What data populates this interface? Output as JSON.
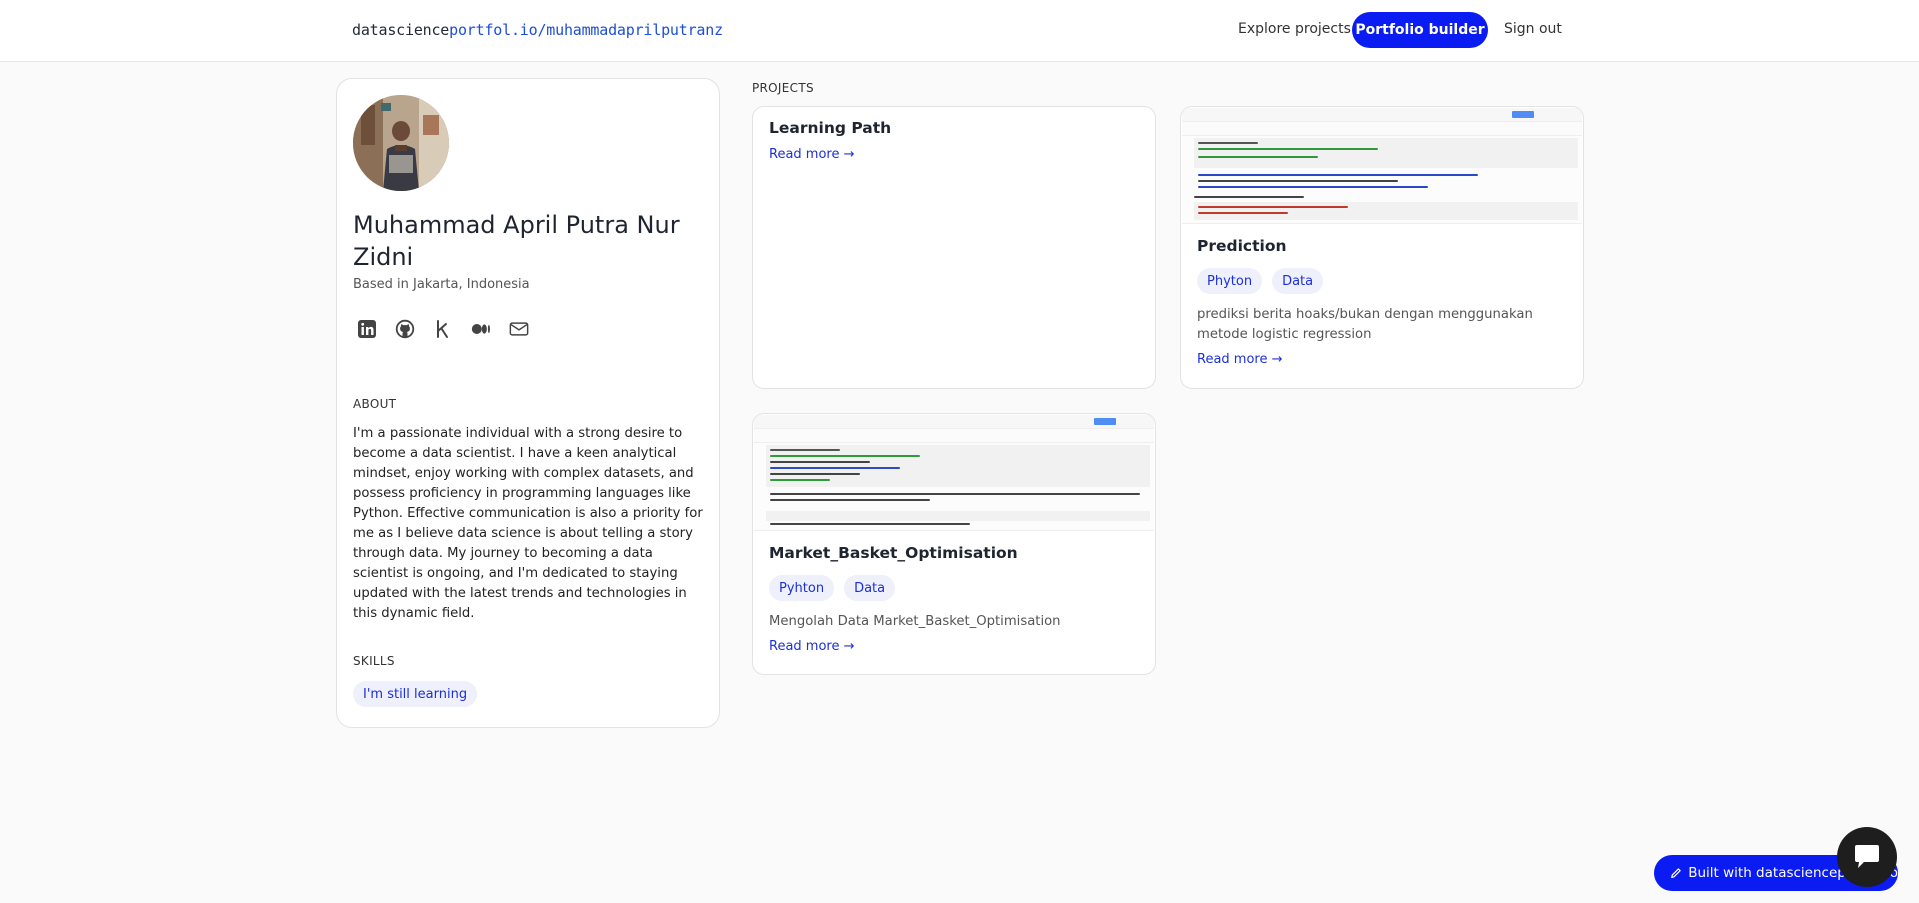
{
  "header": {
    "brand_prefix": "datascience",
    "brand_suffix": "portfol.io/muhammadaprilputranz",
    "explore_label": "Explore projects",
    "builder_label": "Portfolio builder",
    "signout_label": "Sign out"
  },
  "profile": {
    "name": "Muhammad April Putra Nur Zidni",
    "location": "Based in Jakarta, Indonesia",
    "socials": [
      "linkedin-icon",
      "github-icon",
      "kaggle-icon",
      "medium-icon",
      "mail-icon"
    ],
    "about_heading": "ABOUT",
    "about_text": "I'm a passionate individual with a strong desire to become a data scientist. I have a keen analytical mindset, enjoy working with complex datasets, and possess proficiency in programming languages like Python. Effective communication is also a priority for me as I believe data science is about telling a story through data. My journey to becoming a data scientist is ongoing, and I'm dedicated to staying updated with the latest trends and technologies in this dynamic field.",
    "skills_heading": "SKILLS",
    "skills": [
      "I'm still learning"
    ]
  },
  "projects": {
    "heading": "PROJECTS",
    "items": [
      {
        "title": "Learning Path",
        "read_more": "Read more →"
      },
      {
        "title": "Prediction",
        "tags": [
          "Phyton",
          "Data"
        ],
        "description": "prediksi berita hoaks/bukan dengan menggunakan metode logistic regression",
        "read_more": "Read more →"
      },
      {
        "title": "Market_Basket_Optimisation",
        "tags": [
          "Pyhton",
          "Data"
        ],
        "description": "Mengolah Data Market_Basket_Optimisation",
        "read_more": "Read more →"
      }
    ]
  },
  "footer": {
    "built_with": "Built with datascienceportfol.io"
  },
  "colors": {
    "accent": "#0a1cf2",
    "link": "#1d2fd9",
    "chip_bg": "#eef0fc"
  }
}
